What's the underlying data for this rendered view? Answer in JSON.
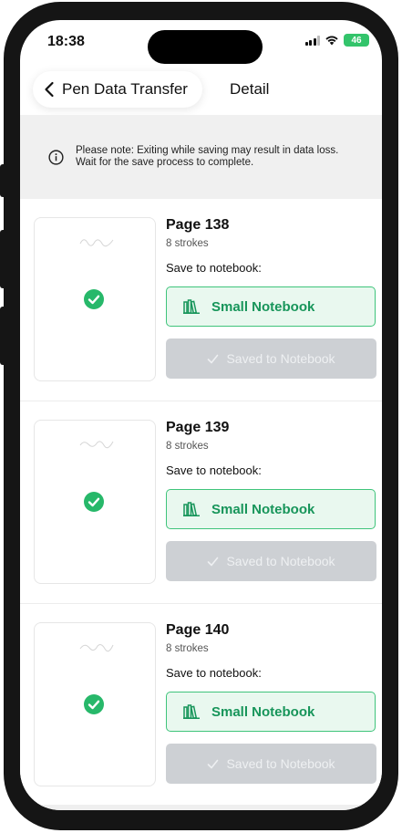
{
  "status_bar": {
    "time": "18:38",
    "battery": "46",
    "icons": [
      "signal-icon",
      "wifi-icon",
      "battery-icon"
    ]
  },
  "nav": {
    "back_label": "Pen Data Transfer",
    "title": "Detail"
  },
  "notice": {
    "icon": "info-icon",
    "text": "Please note: Exiting while saving may result in data loss. Wait for the save process to complete."
  },
  "colors": {
    "accent_green": "#3fc47b",
    "accent_green_text": "#17955a",
    "accent_green_bg": "#e9f8ef",
    "disabled_button": "#cdd0d4",
    "notice_bg": "#f0f0f0"
  },
  "pages": [
    {
      "title": "Page 138",
      "strokes": "8 strokes",
      "save_label": "Save to notebook:",
      "notebook": "Small Notebook",
      "saved_label": "Saved to Notebook",
      "saved": true
    },
    {
      "title": "Page 139",
      "strokes": "8 strokes",
      "save_label": "Save to notebook:",
      "notebook": "Small Notebook",
      "saved_label": "Saved to Notebook",
      "saved": true
    },
    {
      "title": "Page 140",
      "strokes": "8 strokes",
      "save_label": "Save to notebook:",
      "notebook": "Small Notebook",
      "saved_label": "Saved to Notebook",
      "saved": true
    }
  ]
}
